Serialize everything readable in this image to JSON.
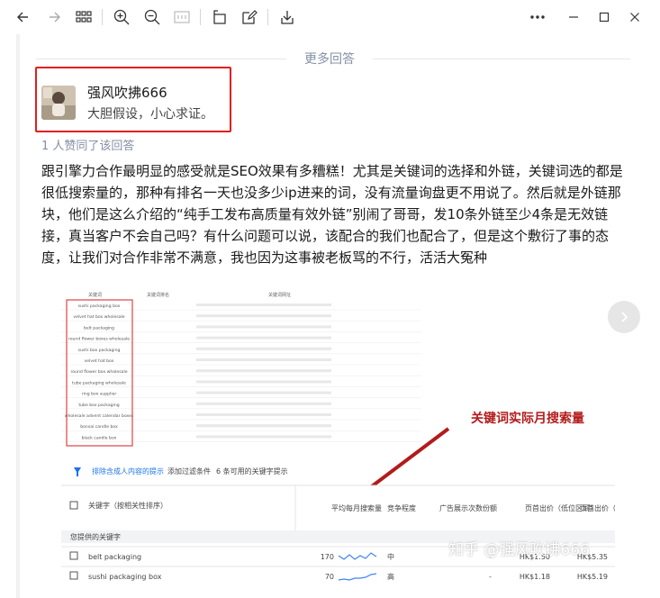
{
  "toolbar": {
    "icons": [
      "back-icon",
      "forward-icon",
      "grid-icon",
      "zoom-in-icon",
      "zoom-out-icon",
      "fit-icon",
      "rotate-icon",
      "edit-icon",
      "download-icon",
      "more-icon",
      "minimize-icon",
      "maximize-icon",
      "close-icon"
    ]
  },
  "section": {
    "more_answers": "更多回答"
  },
  "answer": {
    "author": "强风吹拂666",
    "headline": "大胆假设，小心求证。",
    "votes": "1 人赞同了该回答",
    "body": "跟引擎力合作最明显的感受就是SEO效果有多糟糕！尤其是关键词的选择和外链，关键词选的都是很低搜索量的，那种有排名一天也没多少ip进来的词，没有流量询盘更不用说了。然后就是外链那块，他们是这么介绍的“纯手工发布高质量有效外链”别闹了哥哥，发10条外链至少4条是无效链接，真当客户不会自己吗？有什么问题可以说，该配合的我们也配合了，但是这个敷衍了事的态度，让我们对合作非常不满意，我也因为这事被老板骂的不行，活活大冤种"
  },
  "figure": {
    "annotation": "关键词实际月搜索量",
    "table1_keywords": [
      "sushi packaging box",
      "velvet hat box wholesale",
      "belt packaging",
      "round flower boxes wholesale",
      "sushi box packaging",
      "velvet hat box",
      "round flower box wholesale",
      "tube packaging wholesale",
      "ring box supplier",
      "tube box packaging",
      "wholesale advent calendar boxes",
      "bonsai candle box",
      "black candle box"
    ],
    "filter_bar": [
      "排除含成人内容的提示",
      "添加过滤条件",
      "6 条可用的关键字提示"
    ],
    "table2_headers": [
      "关键字（按相关性排序）",
      "平均每月搜索量",
      "竞争程度",
      "广告展示次数份额",
      "页首出价（低位区间）",
      "页首出价（高位区间）"
    ],
    "table2_section": "您提供的关键字",
    "table2_rows": [
      {
        "keyword": "belt packaging",
        "volume": "170",
        "competition": "中",
        "share": "-",
        "low": "HK$1.50",
        "high": "HK$5.35"
      },
      {
        "keyword": "sushi packaging box",
        "volume": "70",
        "competition": "高",
        "share": "-",
        "low": "HK$1.18",
        "high": "HK$5.19"
      }
    ],
    "watermark": "知乎 @强风吹拂666"
  },
  "colors": {
    "highlight_box": "#e41d1d",
    "muted": "#8590a6",
    "accent": "#1a73e8",
    "arrow": "#b31b1b"
  }
}
